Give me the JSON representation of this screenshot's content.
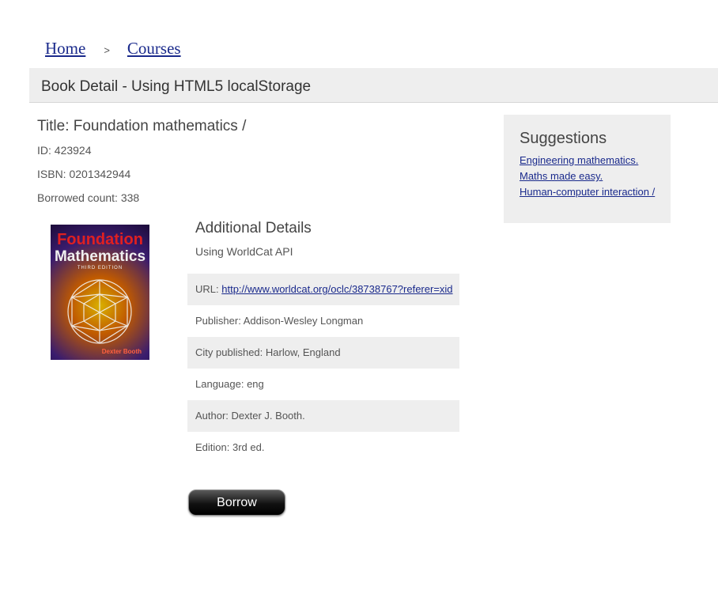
{
  "breadcrumb": {
    "home": "Home",
    "separator": ">",
    "courses": "Courses"
  },
  "header": {
    "title": "Book Detail - Using HTML5 localStorage"
  },
  "book": {
    "title": "Title: Foundation mathematics /",
    "id": "ID: 423924",
    "isbn": "ISBN: 0201342944",
    "borrowed": "Borrowed count: 338"
  },
  "cover": {
    "line1": "Foundation",
    "line2": "Mathematics",
    "edition": "THIRD EDITION",
    "author": "Dexter Booth"
  },
  "additional": {
    "title": "Additional Details",
    "subtitle": "Using WorldCat API",
    "url_label": "URL: ",
    "url": "http://www.worldcat.org/oclc/38738767?referer=xid",
    "publisher": "Publisher: Addison-Wesley Longman",
    "city": "City published: Harlow, England",
    "language": "Language: eng",
    "author": "Author: Dexter J. Booth.",
    "edition": "Edition: 3rd ed."
  },
  "borrow_label": "Borrow",
  "suggestions": {
    "title": "Suggestions",
    "items": [
      "Engineering mathematics.",
      "Maths made easy.",
      "Human-computer interaction /"
    ]
  }
}
